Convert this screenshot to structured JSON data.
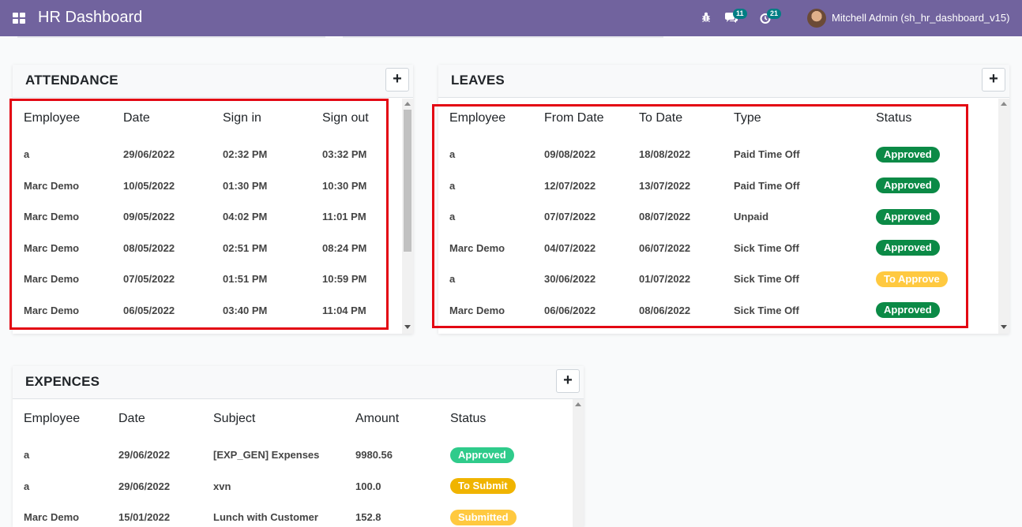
{
  "app": {
    "title": "HR Dashboard"
  },
  "systray": {
    "debug_icon": "bug-icon",
    "messages_count": "11",
    "activities_count": "21",
    "user_name": "Mitchell Admin (sh_hr_dashboard_v15)"
  },
  "colors": {
    "topbar": "#71639e",
    "approved_dark": "#0b8a46",
    "approved_light": "#2fcb8b",
    "to_approve": "#ffc940",
    "to_submit": "#f0b400",
    "submitted": "#ffc940",
    "highlight": "#e30613"
  },
  "attendance": {
    "title": "ATTENDANCE",
    "add_label": "+",
    "columns": [
      "Employee",
      "Date",
      "Sign in",
      "Sign out"
    ],
    "rows": [
      [
        "a",
        "29/06/2022",
        "02:32 PM",
        "03:32 PM"
      ],
      [
        "Marc Demo",
        "10/05/2022",
        "01:30 PM",
        "10:30 PM"
      ],
      [
        "Marc Demo",
        "09/05/2022",
        "04:02 PM",
        "11:01 PM"
      ],
      [
        "Marc Demo",
        "08/05/2022",
        "02:51 PM",
        "08:24 PM"
      ],
      [
        "Marc Demo",
        "07/05/2022",
        "01:51 PM",
        "10:59 PM"
      ],
      [
        "Marc Demo",
        "06/05/2022",
        "03:40 PM",
        "11:04 PM"
      ]
    ]
  },
  "leaves": {
    "title": "LEAVES",
    "add_label": "+",
    "columns": [
      "Employee",
      "From Date",
      "To Date",
      "Type",
      "Status"
    ],
    "rows": [
      [
        "a",
        "09/08/2022",
        "18/08/2022",
        "Paid Time Off",
        "Approved"
      ],
      [
        "a",
        "12/07/2022",
        "13/07/2022",
        "Paid Time Off",
        "Approved"
      ],
      [
        "a",
        "07/07/2022",
        "08/07/2022",
        "Unpaid",
        "Approved"
      ],
      [
        "Marc Demo",
        "04/07/2022",
        "06/07/2022",
        "Sick Time Off",
        "Approved"
      ],
      [
        "a",
        "30/06/2022",
        "01/07/2022",
        "Sick Time Off",
        "To Approve"
      ],
      [
        "Marc Demo",
        "06/06/2022",
        "08/06/2022",
        "Sick Time Off",
        "Approved"
      ]
    ]
  },
  "expences": {
    "title": "EXPENCES",
    "add_label": "+",
    "columns": [
      "Employee",
      "Date",
      "Subject",
      "Amount",
      "Status"
    ],
    "rows": [
      [
        "a",
        "29/06/2022",
        "[EXP_GEN] Expenses",
        "9980.56",
        "Approved"
      ],
      [
        "a",
        "29/06/2022",
        "xvn",
        "100.0",
        "To Submit"
      ],
      [
        "Marc Demo",
        "15/01/2022",
        "Lunch with Customer",
        "152.8",
        "Submitted"
      ]
    ]
  }
}
